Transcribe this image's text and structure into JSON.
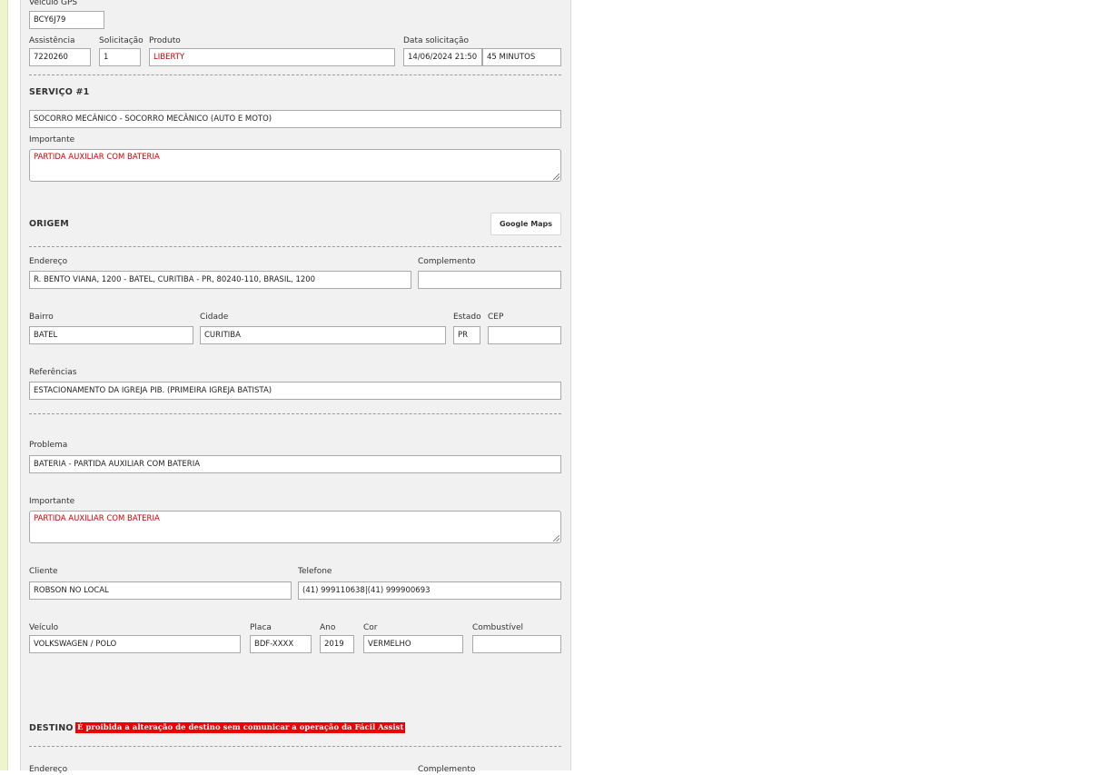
{
  "top": {
    "veiculo_gps_label": "Veículo GPS",
    "veiculo_gps_value": "BCY6J79",
    "assistencia_label": "Assistência",
    "assistencia_value": "7220260",
    "solicitacao_label": "Solicitação",
    "solicitacao_value": "1",
    "produto_label": "Produto",
    "produto_value": "LIBERTY",
    "data_solicitacao_label": "Data solicitação",
    "data_solicitacao_value": "14/06/2024 21:50",
    "tempo_value": "45 MINUTOS"
  },
  "servico": {
    "title": "SERVIÇO #1",
    "tipo_value": "SOCORRO MECÂNICO - SOCORRO MECÂNICO (AUTO E MOTO)",
    "importante_label": "Importante",
    "importante_value": "PARTIDA AUXILIAR COM BATERIA"
  },
  "origem": {
    "title": "ORIGEM",
    "maps_button": "Google Maps",
    "endereco_label": "Endereço",
    "endereco_value": "R. BENTO VIANA, 1200 - BATEL, CURITIBA - PR, 80240-110, BRASIL, 1200",
    "complemento_label": "Complemento",
    "complemento_value": "",
    "bairro_label": "Bairro",
    "bairro_value": "BATEL",
    "cidade_label": "Cidade",
    "cidade_value": "CURITIBA",
    "estado_label": "Estado",
    "estado_value": "PR",
    "cep_label": "CEP",
    "cep_value": "",
    "referencias_label": "Referências",
    "referencias_value": "ESTACIONAMENTO DA IGREJA PIB. (PRIMEIRA IGREJA BATISTA)"
  },
  "detalhes": {
    "problema_label": "Problema",
    "problema_value": "BATERIA - PARTIDA AUXILIAR COM BATERIA",
    "importante_label": "Importante",
    "importante_value": "PARTIDA AUXILIAR COM BATERIA",
    "cliente_label": "Cliente",
    "cliente_value": "ROBSON NO LOCAL",
    "telefone_label": "Telefone",
    "telefone_value": "(41) 999110638|(41) 999900693",
    "veiculo_label": "Veículo",
    "veiculo_value": "VOLKSWAGEN / POLO",
    "placa_label": "Placa",
    "placa_value": "BDF-XXXX",
    "ano_label": "Ano",
    "ano_value": "2019",
    "cor_label": "Cor",
    "cor_value": "VERMELHO",
    "combustivel_label": "Combustível",
    "combustivel_value": ""
  },
  "destino": {
    "title": "DESTINO",
    "warning": "É proibida a alteração de destino sem comunicar a operação da Fácil Assist",
    "endereco_label": "Endereço",
    "complemento_label": "Complemento"
  },
  "colors": {
    "panel_bg": "#f1f1f1",
    "left_strip": "#eef4cc",
    "highlight_text": "#d40000",
    "warning_bg": "#ee0000"
  }
}
